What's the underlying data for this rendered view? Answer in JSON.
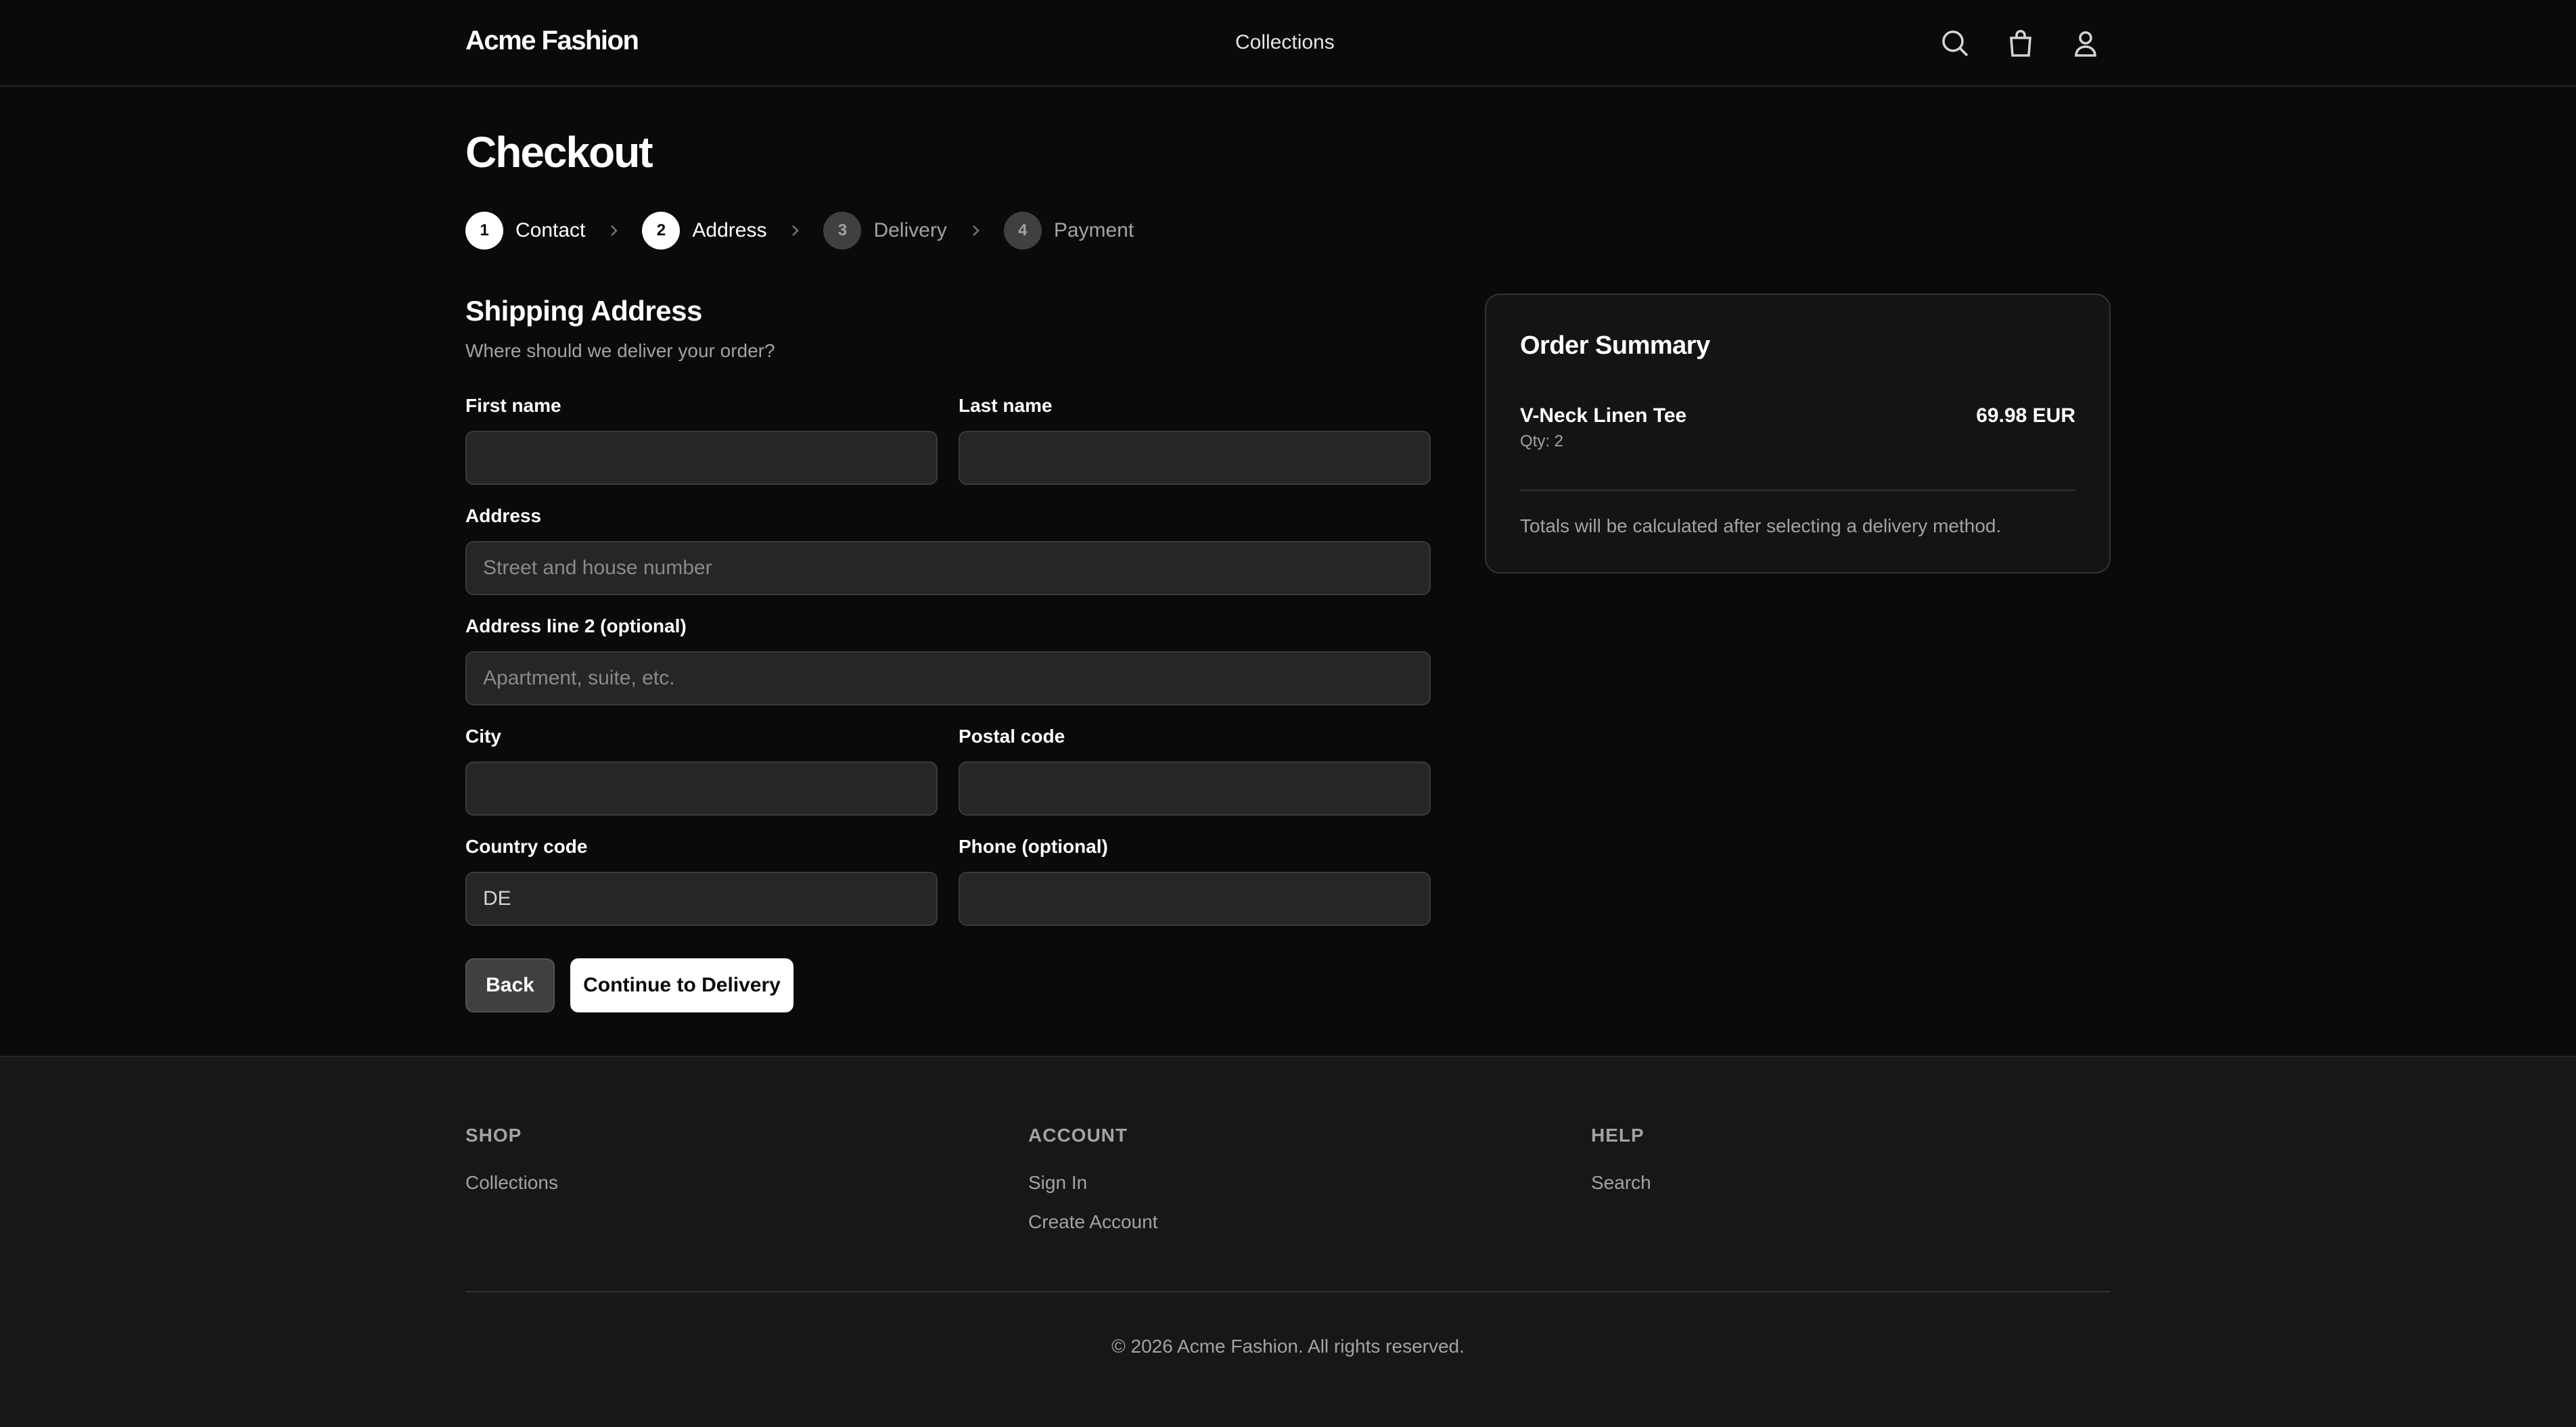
{
  "header": {
    "logo": "Acme Fashion",
    "nav": [
      "Collections"
    ],
    "icons": [
      "search-icon",
      "shopping-bag-icon",
      "user-icon"
    ]
  },
  "page": {
    "title": "Checkout"
  },
  "steps": [
    {
      "number": "1",
      "label": "Contact",
      "state": "complete"
    },
    {
      "number": "2",
      "label": "Address",
      "state": "current"
    },
    {
      "number": "3",
      "label": "Delivery",
      "state": "upcoming"
    },
    {
      "number": "4",
      "label": "Payment",
      "state": "upcoming"
    }
  ],
  "form": {
    "title": "Shipping Address",
    "subtitle": "Where should we deliver your order?",
    "fields": {
      "first_name": {
        "label": "First name",
        "value": "",
        "placeholder": ""
      },
      "last_name": {
        "label": "Last name",
        "value": "",
        "placeholder": ""
      },
      "address": {
        "label": "Address",
        "value": "",
        "placeholder": "Street and house number"
      },
      "address2": {
        "label": "Address line 2 (optional)",
        "value": "",
        "placeholder": "Apartment, suite, etc."
      },
      "city": {
        "label": "City",
        "value": "",
        "placeholder": ""
      },
      "postal_code": {
        "label": "Postal code",
        "value": "",
        "placeholder": ""
      },
      "country_code": {
        "label": "Country code",
        "value": "DE",
        "placeholder": ""
      },
      "phone": {
        "label": "Phone (optional)",
        "value": "",
        "placeholder": ""
      }
    },
    "back_label": "Back",
    "continue_label": "Continue to Delivery"
  },
  "summary": {
    "title": "Order Summary",
    "items": [
      {
        "name": "V-Neck Linen Tee",
        "qty": "Qty: 2",
        "price": "69.98 EUR"
      }
    ],
    "note": "Totals will be calculated after selecting a delivery method."
  },
  "footer": {
    "columns": [
      {
        "title": "SHOP",
        "links": [
          "Collections"
        ]
      },
      {
        "title": "ACCOUNT",
        "links": [
          "Sign In",
          "Create Account"
        ]
      },
      {
        "title": "HELP",
        "links": [
          "Search"
        ]
      }
    ],
    "copyright": "© 2026 Acme Fashion. All rights reserved."
  }
}
